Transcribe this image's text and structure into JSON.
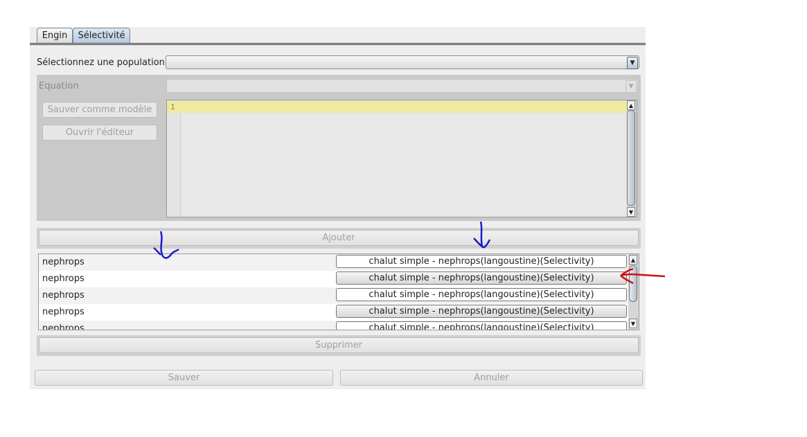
{
  "tabs": [
    {
      "label": "Engin",
      "active": false
    },
    {
      "label": "Sélectivité",
      "active": true
    }
  ],
  "population": {
    "label": "Sélectionnez une population",
    "value": ""
  },
  "equation": {
    "label": "Equation",
    "value": ""
  },
  "buttons": {
    "save_model": "Sauver comme modèle",
    "open_editor": "Ouvrir l'éditeur",
    "add": "Ajouter",
    "remove": "Supprimer",
    "save": "Sauver",
    "cancel": "Annuler"
  },
  "editor": {
    "line_number": "1"
  },
  "table_rows": [
    {
      "population": "nephrops",
      "selectivity": "chalut simple - nephrops(langoustine)(Selectivity)"
    },
    {
      "population": "nephrops",
      "selectivity": "chalut simple - nephrops(langoustine)(Selectivity)"
    },
    {
      "population": "nephrops",
      "selectivity": "chalut simple - nephrops(langoustine)(Selectivity)"
    },
    {
      "population": "nephrops",
      "selectivity": "chalut simple - nephrops(langoustine)(Selectivity)"
    },
    {
      "population": "nephrops",
      "selectivity": "chalut simple - nephrops(langoustine)(Selectivity)"
    }
  ],
  "annotation_colors": {
    "blue": "#1a1acc",
    "red": "#cc1111"
  },
  "colors": {
    "editor_highlight": "#eeeaa0",
    "panel_gray": "#c9c9c9"
  }
}
